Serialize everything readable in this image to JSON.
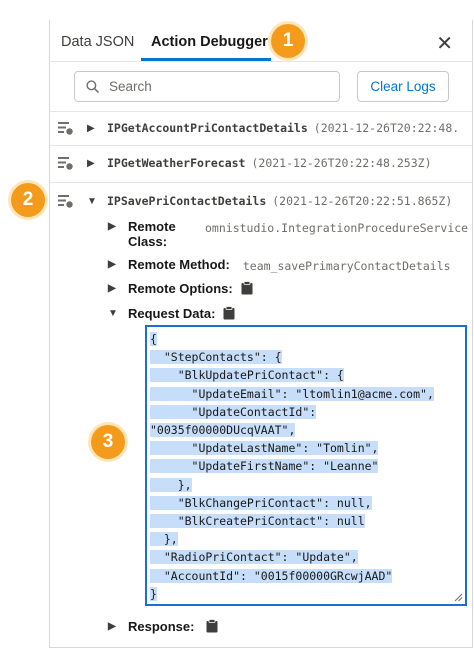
{
  "tabs": [
    {
      "label": "Data JSON"
    },
    {
      "label": "Action Debugger"
    }
  ],
  "badges": [
    "1",
    "2",
    "3"
  ],
  "search": {
    "placeholder": "Search",
    "value": ""
  },
  "clear_logs_label": "Clear Logs",
  "logs": [
    {
      "name": "IPGetAccountPriContactDetails",
      "time": "(2021-12-26T20:22:48."
    },
    {
      "name": "IPGetWeatherForecast",
      "time": "(2021-12-26T20:22:48.253Z)"
    },
    {
      "name": "IPSavePriContactDetails",
      "time": "(2021-12-26T20:22:51.865Z)"
    }
  ],
  "details": {
    "remote_class_label": "Remote Class:",
    "remote_class_value": "omnistudio.IntegrationProcedureService",
    "remote_method_label": "Remote Method:",
    "remote_method_value": "team_savePrimaryContactDetails",
    "remote_options_label": "Remote Options:",
    "request_data_label": "Request Data:",
    "response_label": "Response:"
  },
  "request_json_lines": [
    "{",
    "  \"StepContacts\": {",
    "    \"BlkUpdatePriContact\": {",
    "      \"UpdateEmail\": \"ltomlin1@acme.com\",",
    "      \"UpdateContactId\":",
    "\"0035f00000DUcqVAAT\",",
    "      \"UpdateLastName\": \"Tomlin\",",
    "      \"UpdateFirstName\": \"Leanne\"",
    "    },",
    "    \"BlkChangePriContact\": null,",
    "    \"BlkCreatePriContact\": null",
    "  },",
    "  \"RadioPriContact\": \"Update\",",
    "  \"AccountId\": \"0015f00000GRcwjAAD\"",
    "}"
  ],
  "colors": {
    "accent": "#0176d3",
    "badge": "#f59b1c",
    "selection": "#c7defa"
  }
}
